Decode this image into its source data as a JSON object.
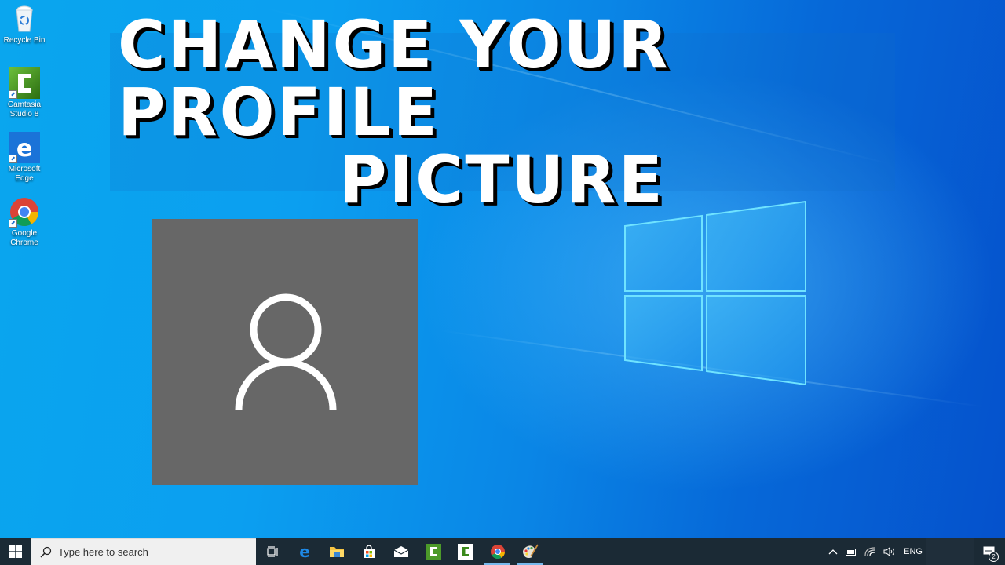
{
  "desktop": {
    "icons": [
      {
        "name": "recycle-bin",
        "label": "Recycle Bin"
      },
      {
        "name": "camtasia-studio",
        "label": "Camtasia Studio 8"
      },
      {
        "name": "microsoft-edge",
        "label": "Microsoft Edge"
      },
      {
        "name": "google-chrome",
        "label": "Google Chrome"
      }
    ],
    "banner": {
      "line1": "CHANGE YOUR PROFILE",
      "line2": "PICTURE"
    },
    "profile_picture": {
      "icon": "person-icon",
      "background": "#676767"
    },
    "colors": {
      "wallpaper_light": "#0aa6ee",
      "wallpaper_dark": "#0551cc",
      "taskbar": "#1b2a35",
      "running_indicator": "#76b9ed"
    }
  },
  "taskbar": {
    "start_icon": "windows-logo-icon",
    "search_placeholder": "Type here to search",
    "pinned_apps": [
      {
        "name": "task-view",
        "icon": "task-view-icon",
        "running": false
      },
      {
        "name": "edge",
        "icon": "edge-icon",
        "running": false
      },
      {
        "name": "file-explorer",
        "icon": "folder-icon",
        "running": false
      },
      {
        "name": "microsoft-store",
        "icon": "store-icon",
        "running": false
      },
      {
        "name": "mail",
        "icon": "mail-icon",
        "running": false
      },
      {
        "name": "camtasia-studio",
        "icon": "camtasia-icon",
        "running": false
      },
      {
        "name": "camtasia-recorder",
        "icon": "camtasia-recorder-icon",
        "running": false
      },
      {
        "name": "chrome",
        "icon": "chrome-icon",
        "running": true
      },
      {
        "name": "paint",
        "icon": "paint-palette-icon",
        "running": true
      }
    ],
    "tray": {
      "language": "ENG",
      "notification_count": "2"
    }
  }
}
